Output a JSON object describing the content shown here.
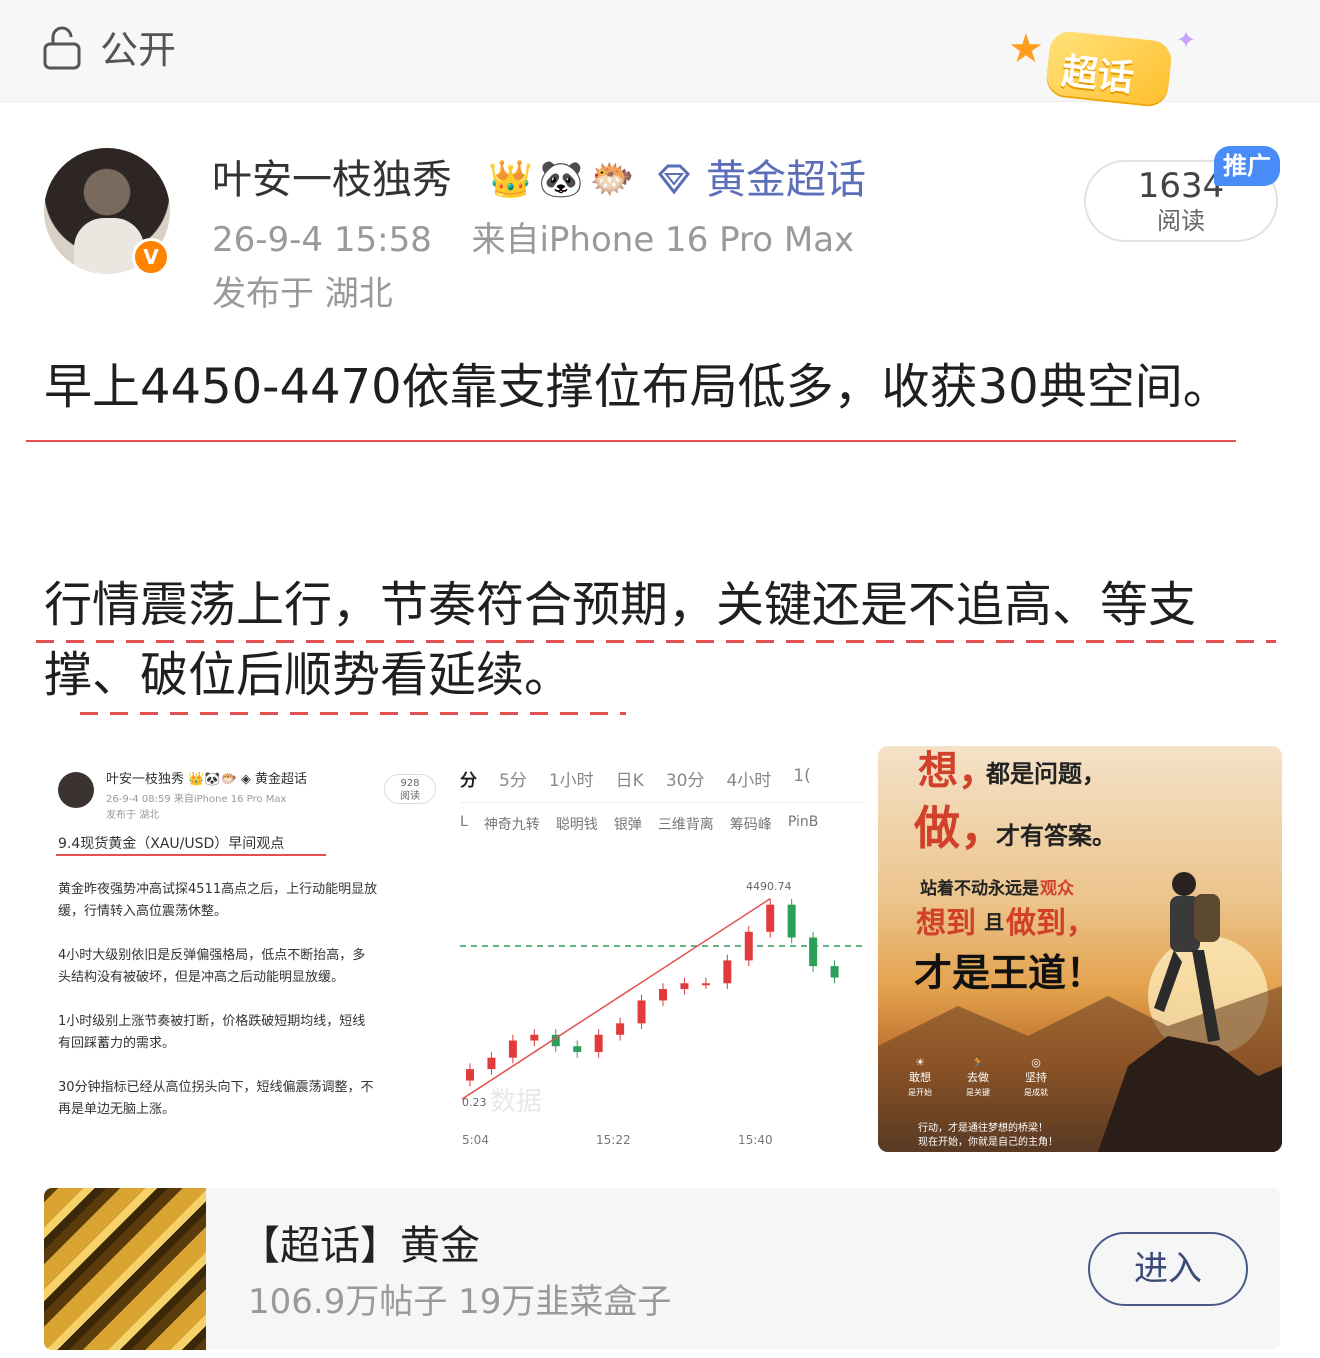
{
  "header": {
    "visibility_label": "公开",
    "badge_label": "超话"
  },
  "post": {
    "author": "叶安一枝独秀",
    "author_badges": [
      "👑",
      "🐼",
      "🐡"
    ],
    "topic_tag": "黄金超话",
    "time": "26-9-4 15:58",
    "source": "来自iPhone 16 Pro Max",
    "location": "发布于 湖北",
    "read_count": "1634",
    "read_label": "阅读",
    "promo_label": "推广",
    "paragraphs": [
      "早上4450-4470依靠支撑位布局低多，收获30典空间。",
      "行情震荡上行，节奏符合预期，关键还是不追高、等支撑、破位后顺势看延续。"
    ]
  },
  "image1": {
    "author": "叶安一枝独秀 👑🐼🐡 ◈ 黄金超话",
    "meta": "26-9-4 08:59  来自iPhone 16 Pro Max",
    "location": "发布于 湖北",
    "read_count": "928",
    "read_label": "阅读",
    "title": "9.4现货黄金（XAU/USD）早间观点",
    "lines": [
      "黄金昨夜强势冲高试探4511高点之后，上行动能明显放",
      "缓，行情转入高位震荡休整。",
      "4小时大级别依旧是反弹偏强格局，低点不断抬高，多",
      "头结构没有被破坏，但是冲高之后动能明显放缓。",
      "1小时级别上涨节奏被打断，价格跌破短期均线，短线",
      "有回踩蓄力的需求。",
      "30分钟指标已经从高位拐头向下，短线偏震荡调整，不",
      "再是单边无脑上涨。"
    ]
  },
  "image2": {
    "tabs": [
      "分",
      "5分",
      "1小时",
      "日K",
      "30分",
      "4小时",
      "1("
    ],
    "indicators": [
      "L",
      "神奇九转",
      "聪明钱",
      "银弹",
      "三维背离",
      "筹码峰",
      "PinB"
    ],
    "peak_label": "4490.74",
    "low_label": "0.23",
    "time_labels": [
      "5:04",
      "15:22",
      "15:40"
    ],
    "watermark": "数据"
  },
  "image3": {
    "line1a": "想，",
    "line1b": "都是问题，",
    "line2a": "做，",
    "line2b": "才有答案。",
    "line3a": "站着不动永远是",
    "line3b": "观众",
    "line4a": "想到",
    "line4b": "且",
    "line4c": "做到，",
    "line5": "才是王道！",
    "icons": [
      "敢想",
      "去做",
      "坚持"
    ],
    "icon_subs": [
      "是开始",
      "是关键",
      "是成就"
    ],
    "footer1": "行动，才是通往梦想的桥梁！",
    "footer2": "现在开始，你就是自己的主角！"
  },
  "topic_card": {
    "title": "【超话】黄金",
    "stats": "106.9万帖子 19万韭菜盒子",
    "enter_label": "进入"
  },
  "chart_data": {
    "type": "line",
    "title": "",
    "x_ticks": [
      "5:04",
      "15:22",
      "15:40"
    ],
    "annotations": [
      "4490.74"
    ],
    "ylabel": "",
    "xlabel": "",
    "series": [
      {
        "values": [
          4462,
          4464,
          4467,
          4468,
          4466,
          4465,
          4468,
          4470,
          4474,
          4476,
          4477,
          4477,
          4481,
          4486,
          4490.74,
          4485,
          4480,
          4478
        ]
      }
    ]
  },
  "colors": {
    "link": "#5b6fb8",
    "underline": "#e35050",
    "promo": "#4a8cf7",
    "vip": "#ff8200"
  }
}
